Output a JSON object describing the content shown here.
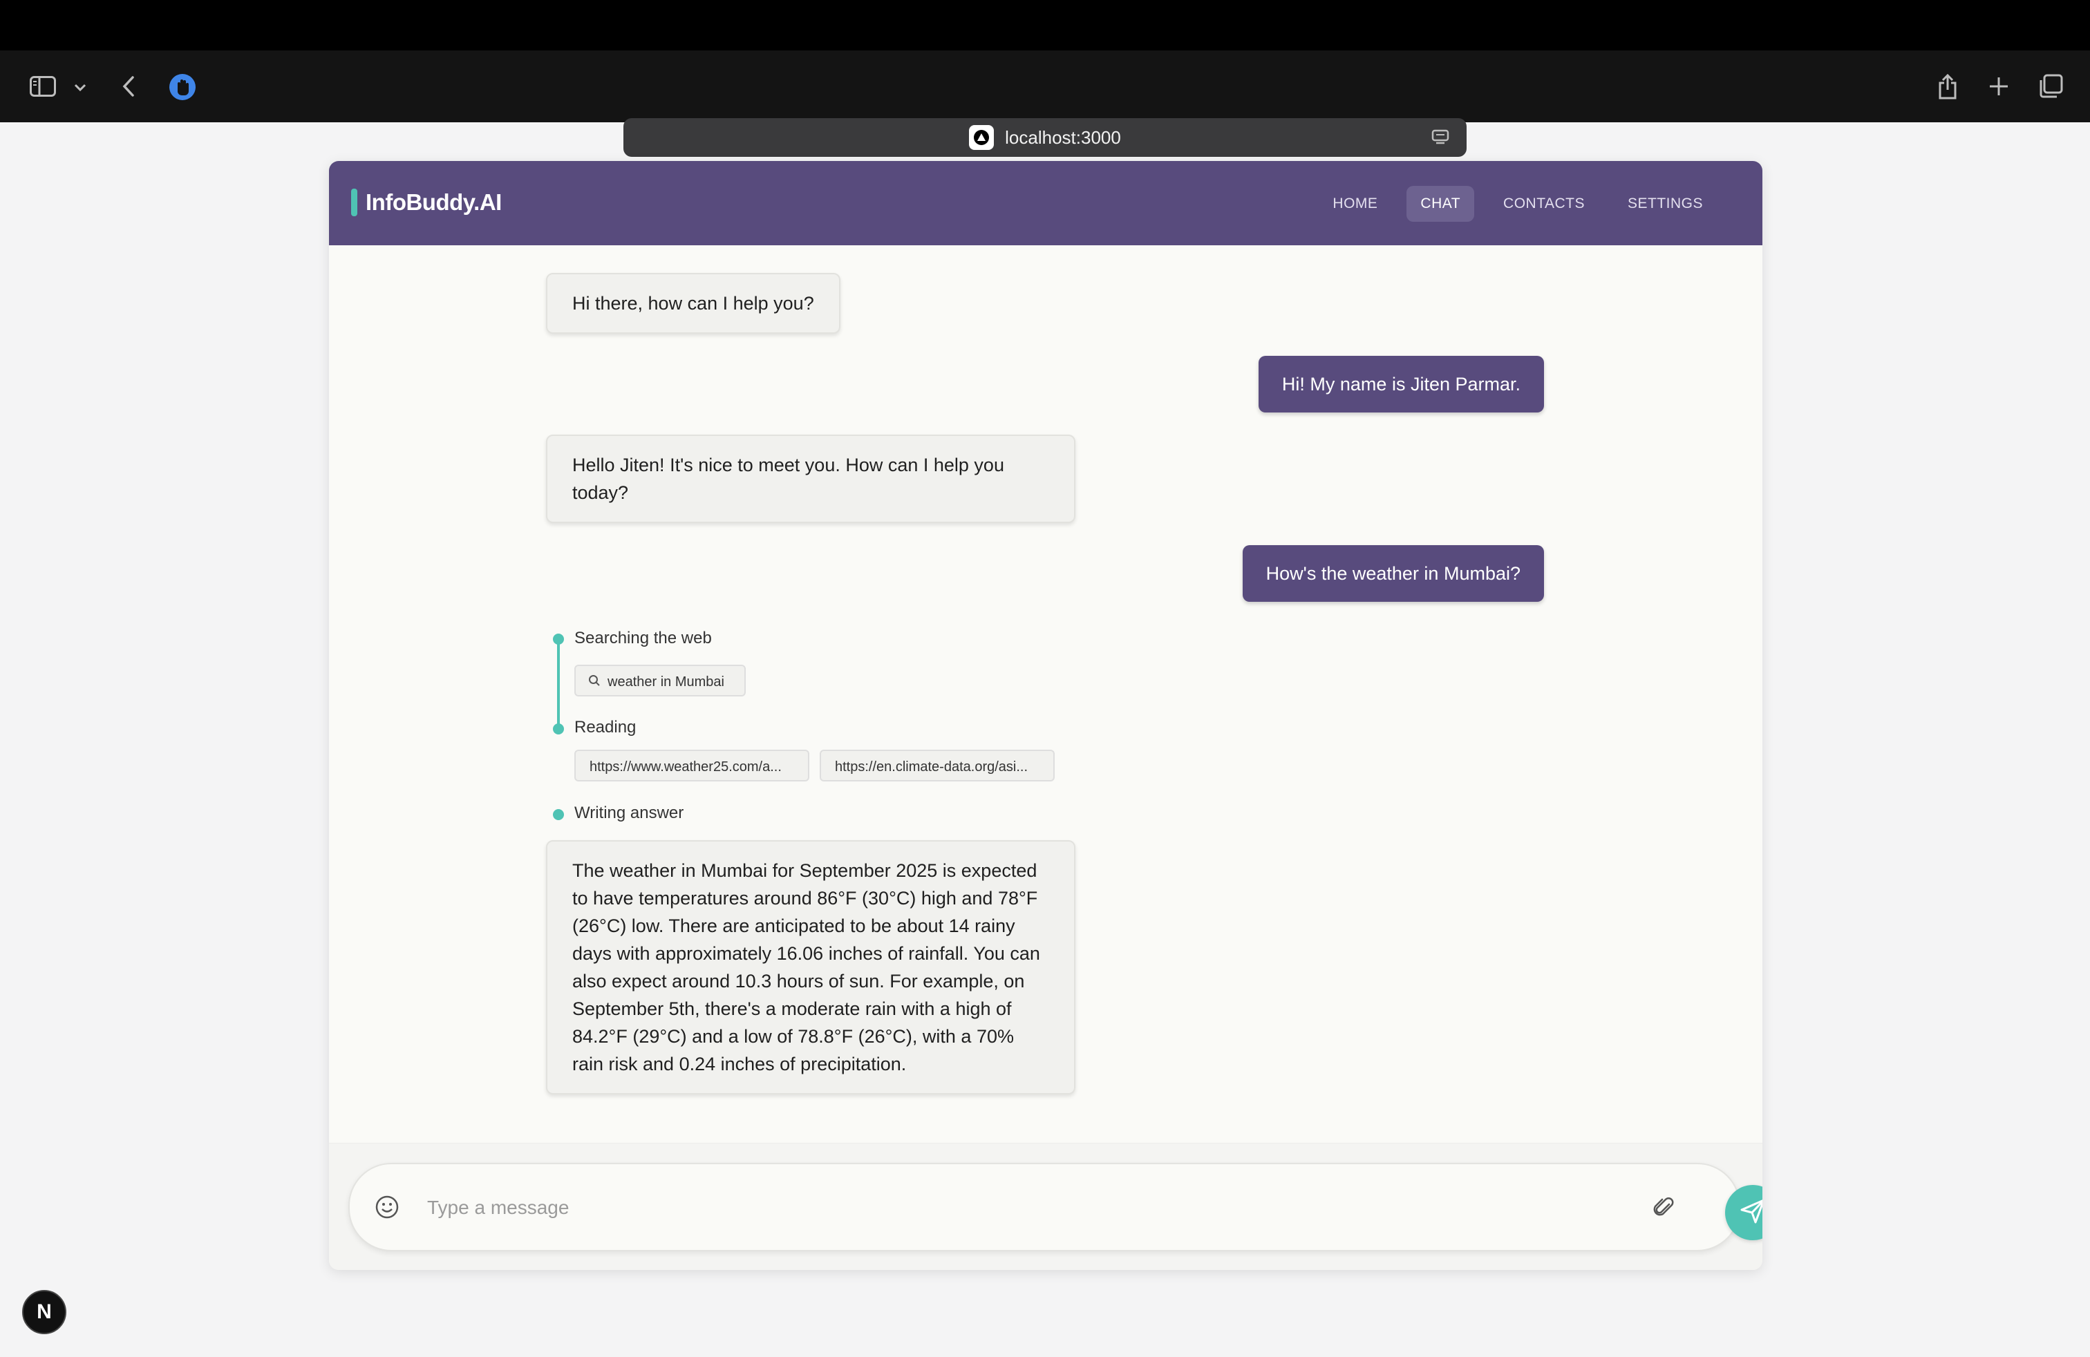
{
  "browser": {
    "url": "localhost:3000"
  },
  "app": {
    "brand": "InfoBuddy.AI",
    "nav": [
      {
        "label": "HOME",
        "active": false
      },
      {
        "label": "CHAT",
        "active": true
      },
      {
        "label": "CONTACTS",
        "active": false
      },
      {
        "label": "SETTINGS",
        "active": false
      }
    ]
  },
  "messages": [
    {
      "role": "bot",
      "text": "Hi there, how can I help you?"
    },
    {
      "role": "user",
      "text": "Hi! My name is Jiten Parmar."
    },
    {
      "role": "bot",
      "text": "Hello Jiten! It's nice to meet you. How can I help you today?"
    },
    {
      "role": "user",
      "text": "How's the weather in Mumbai?"
    }
  ],
  "steps": {
    "searching": {
      "label": "Searching the web",
      "query": "weather in Mumbai"
    },
    "reading": {
      "label": "Reading",
      "sources": [
        "https://www.weather25.com/a...",
        "https://en.climate-data.org/asi..."
      ]
    },
    "writing": {
      "label": "Writing answer"
    }
  },
  "answer": "The weather in Mumbai for September 2025 is expected to have temperatures around 86°F (30°C) high and 78°F (26°C) low. There are anticipated to be about 14 rainy days with approximately 16.06 inches of rainfall. You can also expect around 10.3 hours of sun. For example, on September 5th, there's a moderate rain with a high of 84.2°F (29°C) and a low of 78.8°F (26°C), with a 70% rain risk and 0.24 inches of precipitation.",
  "composer": {
    "placeholder": "Type a message"
  },
  "dev_badge": "N",
  "colors": {
    "header": "#584b7d",
    "accent": "#4fc3b4",
    "user_bubble": "#584b7d",
    "bot_bubble": "#f1f1ee"
  }
}
